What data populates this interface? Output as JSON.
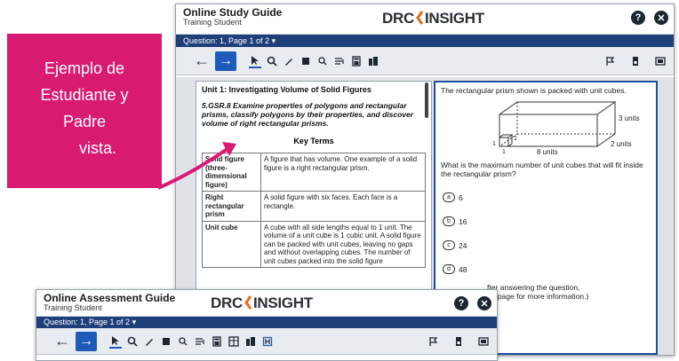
{
  "callout": {
    "line1": "Ejemplo de",
    "line2": "Estudiante y",
    "line3": "Padre",
    "line4": "vista."
  },
  "main_window": {
    "title": "Online Study Guide",
    "subtitle": "Training Student",
    "logo_left": "DRC",
    "logo_right": "INSIGHT",
    "question_nav": "Question: 1, Page 1 of 2 ▾"
  },
  "passage": {
    "unit_title": "Unit 1: Investigating Volume of Solid Figures",
    "standard": "5.GSR.8 Examine properties of polygons and rectangular prisms, classify polygons by their properties, and discover volume of right rectangular prisms.",
    "key_terms_heading": "Key Terms",
    "terms": [
      {
        "term": "Solid figure (three-dimensional figure)",
        "definition": "A figure that has volume. One example of a solid figure is a right rectangular prism."
      },
      {
        "term": "Right rectangular prism",
        "definition": "A solid figure with six faces. Each face is a rectangle."
      },
      {
        "term": "Unit cube",
        "definition": "A cube with all side lengths equal to 1 unit. The volume of a unit cube is 1 cubic unit. A solid figure can be packed with unit cubes, leaving no gaps and without overlapping cubes. The number of unit cubes packed into the solid figure"
      }
    ]
  },
  "question": {
    "stem": "The rectangular prism shown is packed with unit cubes.",
    "figure_labels": {
      "height": "3 units",
      "depth": "2 units",
      "length": "8 units",
      "one_a": "1",
      "one_b": "1",
      "one_c": "1"
    },
    "prompt": "What is the maximum number of unit cubes that will fit inside the rectangular prism?",
    "options": [
      {
        "letter": "a",
        "value": "6"
      },
      {
        "letter": "b",
        "value": "16"
      },
      {
        "letter": "c",
        "value": "24"
      },
      {
        "letter": "d",
        "value": "48"
      }
    ],
    "note_line1": "fter answering the question,",
    "note_line2": "he page for more information.)"
  },
  "second_window": {
    "title": "Online Assessment Guide",
    "subtitle": "Training Student",
    "logo_left": "DRC",
    "logo_right": "INSIGHT",
    "question_nav": "Question: 1, Page 1 of 2 ▾"
  },
  "colors": {
    "callout": "#d91a72",
    "nav_bar": "#1f3f7a",
    "next_button": "#1e5bb8",
    "answer_border": "#1d4f9e"
  }
}
